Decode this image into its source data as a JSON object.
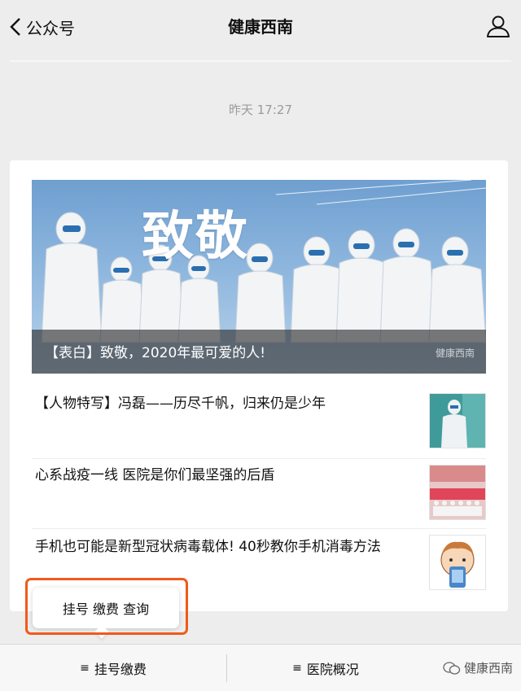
{
  "nav": {
    "back_label": "公众号",
    "title": "健康西南",
    "back_icon": "chevron-left-icon",
    "profile_icon": "person-icon"
  },
  "timestamp": "昨天 17:27",
  "hero": {
    "big_text": "致敬",
    "caption": "【表白】致敬，2020年最可爱的人!",
    "watermark": "健康西南"
  },
  "articles": [
    {
      "title": "【人物特写】冯磊——历尽千帆，归来仍是少年"
    },
    {
      "title": "心系战疫一线 医院是你们最坚强的后盾"
    },
    {
      "title": "手机也可能是新型冠状病毒载体! 40秒教你手机消毒方法"
    }
  ],
  "popup": {
    "label": "挂号 缴费 查询",
    "outline_color": "#f05a1a"
  },
  "bottom_menu": {
    "items": [
      {
        "icon": "menu-icon",
        "label": "挂号缴费"
      },
      {
        "icon": "menu-icon",
        "label": "医院概况"
      }
    ],
    "watermark": "健康西南"
  }
}
